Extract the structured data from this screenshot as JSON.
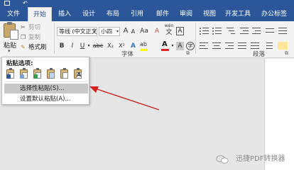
{
  "tabs": [
    {
      "label": "文件",
      "active": false
    },
    {
      "label": "开始",
      "active": true
    },
    {
      "label": "插入",
      "active": false
    },
    {
      "label": "设计",
      "active": false
    },
    {
      "label": "布局",
      "active": false
    },
    {
      "label": "引用",
      "active": false
    },
    {
      "label": "邮件",
      "active": false
    },
    {
      "label": "审阅",
      "active": false
    },
    {
      "label": "视图",
      "active": false
    },
    {
      "label": "开发工具",
      "active": false
    },
    {
      "label": "办公标签",
      "active": false
    }
  ],
  "clipboard": {
    "paste_label": "粘贴",
    "cut_label": "剪切",
    "copy_label": "复制",
    "format_painter_label": "格式刷"
  },
  "font": {
    "font_name": "等线 (中文正文)",
    "font_size": "小四",
    "grow_glyph": "A",
    "shrink_glyph": "A",
    "case_glyph": "Aa",
    "clear_glyph": "A",
    "wen_glyph": "wén",
    "wen_char": "文",
    "border_char": "A",
    "bold": "B",
    "italic": "I",
    "underline": "U",
    "strike": "abc",
    "subscript": "X₂",
    "superscript": "X²",
    "effects_glyph": "A",
    "highlight_glyph": "ab",
    "font_color_glyph": "A",
    "shade_glyph": "A",
    "circle_char": "字",
    "group_label": "字体"
  },
  "paragraph": {
    "group_label": "段落"
  },
  "colors": {
    "accent": "#2b579a",
    "highlight": "#ffff00",
    "font_color": "#e02020",
    "arrow": "#d42020"
  },
  "paste_options": {
    "title": "粘贴选项:",
    "icon_names": [
      "keep-source-formatting-icon",
      "merge-formatting-icon",
      "use-destination-styles-icon",
      "picture-icon",
      "keep-text-only-icon",
      "text-only-icon"
    ],
    "items": [
      {
        "label": "选择性粘贴(S)...",
        "highlighted": true
      },
      {
        "label": "设置默认粘贴(A)...",
        "highlighted": false
      }
    ]
  },
  "watermark": {
    "text": "迅捷PDF转换器"
  }
}
